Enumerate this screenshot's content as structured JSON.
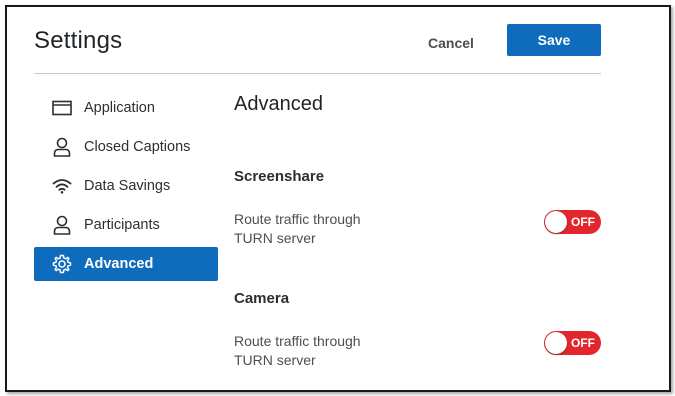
{
  "header": {
    "title": "Settings",
    "cancel_label": "Cancel",
    "save_label": "Save"
  },
  "sidebar": {
    "items": [
      {
        "label": "Application",
        "icon": "window-icon",
        "active": false
      },
      {
        "label": "Closed Captions",
        "icon": "person-icon",
        "active": false
      },
      {
        "label": "Data Savings",
        "icon": "wifi-icon",
        "active": false
      },
      {
        "label": "Participants",
        "icon": "person-icon",
        "active": false
      },
      {
        "label": "Advanced",
        "icon": "gear-icon",
        "active": true
      }
    ]
  },
  "main": {
    "section_title": "Advanced",
    "groups": [
      {
        "title": "Screenshare",
        "label_line1": "Route traffic through",
        "label_line2": "TURN server",
        "toggle_state": "OFF"
      },
      {
        "title": "Camera",
        "label_line1": "Route traffic through",
        "label_line2": "TURN server",
        "toggle_state": "OFF"
      }
    ]
  },
  "colors": {
    "accent": "#0f6cbd",
    "toggle_off": "#e3262c"
  }
}
